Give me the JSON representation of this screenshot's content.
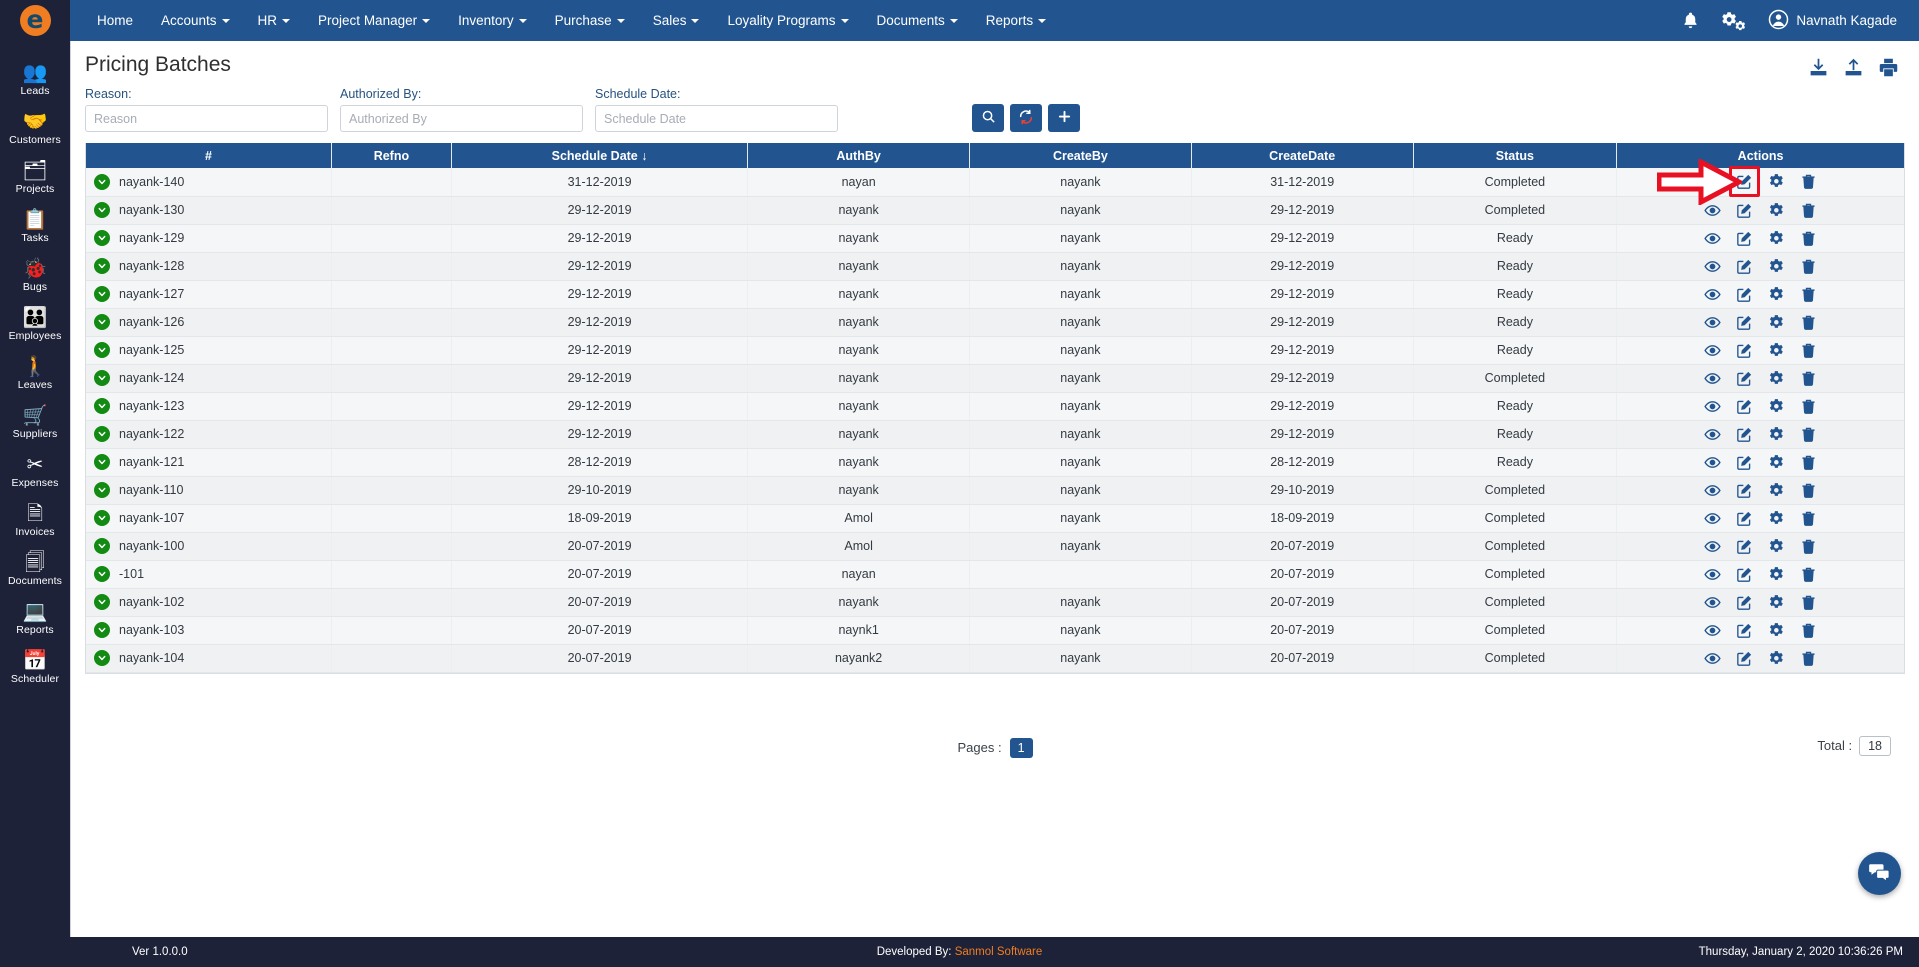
{
  "brand": {
    "logo_glyph": "e",
    "logo_bg": "#f07d21",
    "logo_fg": "#14496e"
  },
  "topnav": {
    "items": [
      {
        "label": "Home",
        "caret": false
      },
      {
        "label": "Accounts",
        "caret": true
      },
      {
        "label": "HR",
        "caret": true
      },
      {
        "label": "Project Manager",
        "caret": true
      },
      {
        "label": "Inventory",
        "caret": true
      },
      {
        "label": "Purchase",
        "caret": true
      },
      {
        "label": "Sales",
        "caret": true
      },
      {
        "label": "Loyality Programs",
        "caret": true
      },
      {
        "label": "Documents",
        "caret": true
      },
      {
        "label": "Reports",
        "caret": true
      }
    ],
    "notification_icon": "bell-icon",
    "settings_icon": "gears-icon",
    "user_icon": "user-avatar-icon",
    "user_name": "Navnath Kagade",
    "bg": "#22558f"
  },
  "sidebar": {
    "items": [
      {
        "label": "Leads",
        "icon": "leads-icon",
        "glyph": "👥"
      },
      {
        "label": "Customers",
        "icon": "customers-icon",
        "glyph": "🤝"
      },
      {
        "label": "Projects",
        "icon": "projects-icon",
        "glyph": "🗂"
      },
      {
        "label": "Tasks",
        "icon": "tasks-icon",
        "glyph": "📋"
      },
      {
        "label": "Bugs",
        "icon": "bugs-icon",
        "glyph": "🐞"
      },
      {
        "label": "Employees",
        "icon": "employees-icon",
        "glyph": "👪"
      },
      {
        "label": "Leaves",
        "icon": "leaves-icon",
        "glyph": "🚶"
      },
      {
        "label": "Suppliers",
        "icon": "suppliers-icon",
        "glyph": "🛒"
      },
      {
        "label": "Expenses",
        "icon": "expenses-icon",
        "glyph": "✂"
      },
      {
        "label": "Invoices",
        "icon": "invoices-icon",
        "glyph": "🗎"
      },
      {
        "label": "Documents",
        "icon": "documents-icon",
        "glyph": "🗐"
      },
      {
        "label": "Reports",
        "icon": "reports-icon",
        "glyph": "💻"
      },
      {
        "label": "Scheduler",
        "icon": "scheduler-icon",
        "glyph": "📅"
      }
    ],
    "bg": "#1d2238"
  },
  "page": {
    "title": "Pricing Batches",
    "tools": [
      {
        "name": "download-icon",
        "label": "Download"
      },
      {
        "name": "upload-icon",
        "label": "Upload"
      },
      {
        "name": "print-icon",
        "label": "Print"
      }
    ]
  },
  "filters": {
    "reason": {
      "label": "Reason:",
      "value": "",
      "placeholder": "Reason"
    },
    "authorized_by": {
      "label": "Authorized By:",
      "value": "",
      "placeholder": "Authorized By"
    },
    "schedule_date": {
      "label": "Schedule Date:",
      "value": "",
      "placeholder": "Schedule Date"
    },
    "buttons": [
      {
        "name": "search-button",
        "icon": "search-icon"
      },
      {
        "name": "refresh-button",
        "icon": "refresh-icon"
      },
      {
        "name": "add-button",
        "icon": "plus-icon"
      }
    ]
  },
  "table": {
    "columns": [
      "#",
      "Refno",
      "Schedule Date ↓",
      "AuthBy",
      "CreateBy",
      "CreateDate",
      "Status",
      "Actions"
    ],
    "sort_column": "Schedule Date",
    "sort_direction": "desc",
    "row_actions": [
      {
        "name": "view-icon",
        "title": "View"
      },
      {
        "name": "edit-icon",
        "title": "Edit"
      },
      {
        "name": "settings-icon",
        "title": "Settings"
      },
      {
        "name": "delete-icon",
        "title": "Delete"
      }
    ],
    "rows": [
      {
        "id": "nayank-140",
        "refno": "",
        "schedule_date": "31-12-2019",
        "authby": "nayan",
        "createby": "nayank",
        "createdate": "31-12-2019",
        "status": "Completed"
      },
      {
        "id": "nayank-130",
        "refno": "",
        "schedule_date": "29-12-2019",
        "authby": "nayank",
        "createby": "nayank",
        "createdate": "29-12-2019",
        "status": "Completed"
      },
      {
        "id": "nayank-129",
        "refno": "",
        "schedule_date": "29-12-2019",
        "authby": "nayank",
        "createby": "nayank",
        "createdate": "29-12-2019",
        "status": "Ready"
      },
      {
        "id": "nayank-128",
        "refno": "",
        "schedule_date": "29-12-2019",
        "authby": "nayank",
        "createby": "nayank",
        "createdate": "29-12-2019",
        "status": "Ready"
      },
      {
        "id": "nayank-127",
        "refno": "",
        "schedule_date": "29-12-2019",
        "authby": "nayank",
        "createby": "nayank",
        "createdate": "29-12-2019",
        "status": "Ready"
      },
      {
        "id": "nayank-126",
        "refno": "",
        "schedule_date": "29-12-2019",
        "authby": "nayank",
        "createby": "nayank",
        "createdate": "29-12-2019",
        "status": "Ready"
      },
      {
        "id": "nayank-125",
        "refno": "",
        "schedule_date": "29-12-2019",
        "authby": "nayank",
        "createby": "nayank",
        "createdate": "29-12-2019",
        "status": "Ready"
      },
      {
        "id": "nayank-124",
        "refno": "",
        "schedule_date": "29-12-2019",
        "authby": "nayank",
        "createby": "nayank",
        "createdate": "29-12-2019",
        "status": "Completed"
      },
      {
        "id": "nayank-123",
        "refno": "",
        "schedule_date": "29-12-2019",
        "authby": "nayank",
        "createby": "nayank",
        "createdate": "29-12-2019",
        "status": "Ready"
      },
      {
        "id": "nayank-122",
        "refno": "",
        "schedule_date": "29-12-2019",
        "authby": "nayank",
        "createby": "nayank",
        "createdate": "29-12-2019",
        "status": "Ready"
      },
      {
        "id": "nayank-121",
        "refno": "",
        "schedule_date": "28-12-2019",
        "authby": "nayank",
        "createby": "nayank",
        "createdate": "28-12-2019",
        "status": "Ready"
      },
      {
        "id": "nayank-110",
        "refno": "",
        "schedule_date": "29-10-2019",
        "authby": "nayank",
        "createby": "nayank",
        "createdate": "29-10-2019",
        "status": "Completed"
      },
      {
        "id": "nayank-107",
        "refno": "",
        "schedule_date": "18-09-2019",
        "authby": "Amol",
        "createby": "nayank",
        "createdate": "18-09-2019",
        "status": "Completed"
      },
      {
        "id": "nayank-100",
        "refno": "",
        "schedule_date": "20-07-2019",
        "authby": "Amol",
        "createby": "nayank",
        "createdate": "20-07-2019",
        "status": "Completed"
      },
      {
        "id": "-101",
        "refno": "",
        "schedule_date": "20-07-2019",
        "authby": "nayan",
        "createby": "",
        "createdate": "20-07-2019",
        "status": "Completed"
      },
      {
        "id": "nayank-102",
        "refno": "",
        "schedule_date": "20-07-2019",
        "authby": "nayank",
        "createby": "nayank",
        "createdate": "20-07-2019",
        "status": "Completed"
      },
      {
        "id": "nayank-103",
        "refno": "",
        "schedule_date": "20-07-2019",
        "authby": "naynk1",
        "createby": "nayank",
        "createdate": "20-07-2019",
        "status": "Completed"
      },
      {
        "id": "nayank-104",
        "refno": "",
        "schedule_date": "20-07-2019",
        "authby": "nayank2",
        "createby": "nayank",
        "createdate": "20-07-2019",
        "status": "Completed"
      }
    ]
  },
  "pager": {
    "pages_label": "Pages :",
    "current_page": "1",
    "total_label": "Total :",
    "total_value": "18"
  },
  "chat": {
    "icon": "chat-bubble-icon"
  },
  "annotation": {
    "arrow_color": "#e81123",
    "highlight_color": "#e81123",
    "target": "edit-icon-row-1"
  },
  "footer": {
    "version": "Ver 1.0.0.0",
    "developed_by_prefix": "Developed By:",
    "developed_by": "Sanmol Software",
    "timestamp": "Thursday, January 2, 2020 10:36:26 PM"
  }
}
